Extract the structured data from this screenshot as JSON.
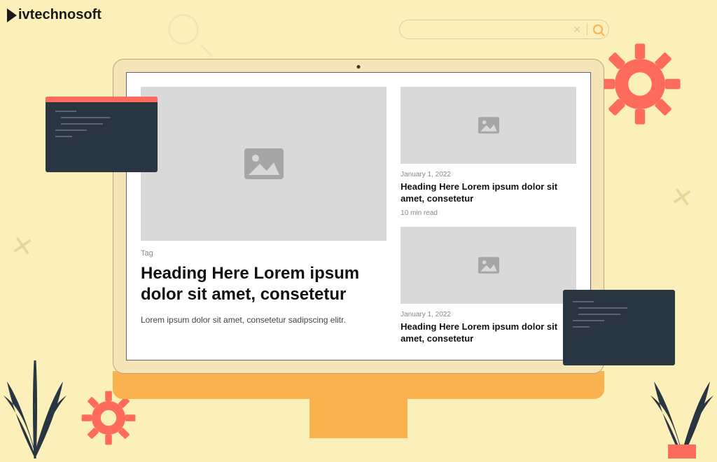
{
  "brand": "ivtechnosoft",
  "main_card": {
    "tag": "Tag",
    "heading": "Heading Here Lorem ipsum dolor sit amet, consetetur",
    "description": "Lorem ipsum dolor sit amet, consetetur sadipscing elitr."
  },
  "side_cards": [
    {
      "date": "January 1, 2022",
      "heading": "Heading Here Lorem ipsum dolor sit amet, consetetur",
      "read_time": "10 min read"
    },
    {
      "date": "January 1, 2022",
      "heading": "Heading Here Lorem ipsum dolor sit amet, consetetur",
      "read_time": ""
    }
  ]
}
